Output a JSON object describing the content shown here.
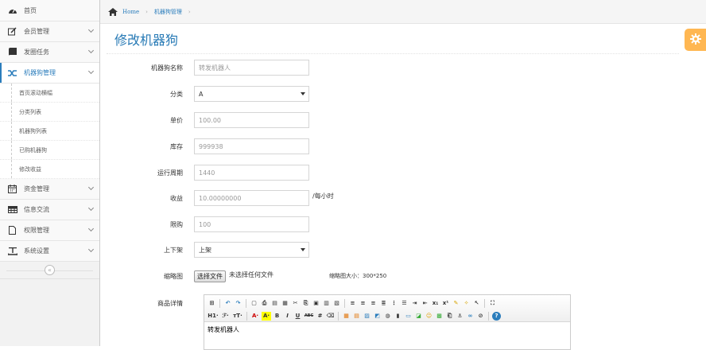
{
  "sidebar": {
    "items": [
      {
        "label": "首页",
        "icon": "dashboard-icon"
      },
      {
        "label": "会员管理",
        "icon": "pencil-square-icon"
      },
      {
        "label": "发圈任务",
        "icon": "book-icon"
      },
      {
        "label": "机器狗管理",
        "icon": "random-icon"
      },
      {
        "label": "资金管理",
        "icon": "calendar-icon"
      },
      {
        "label": "信息交流",
        "icon": "table-icon"
      },
      {
        "label": "权限管理",
        "icon": "file-icon"
      },
      {
        "label": "系统设置",
        "icon": "text-width-icon"
      }
    ],
    "subitems": [
      "首页滚动横幅",
      "分类列表",
      "机器狗列表",
      "已购机器狗",
      "修改收益"
    ],
    "collapse_label": "«"
  },
  "breadcrumb": {
    "home": "Home",
    "current": "机器狗管理"
  },
  "page": {
    "title": "修改机器狗"
  },
  "form": {
    "name": {
      "label": "机器狗名称",
      "placeholder": "转发机器人"
    },
    "category": {
      "label": "分类",
      "value": "A"
    },
    "price": {
      "label": "单价",
      "placeholder": "100.00"
    },
    "stock": {
      "label": "库存",
      "placeholder": "999938"
    },
    "period": {
      "label": "运行周期",
      "placeholder": "1440"
    },
    "income": {
      "label": "收益",
      "placeholder": "10.00000000",
      "suffix": "/每小时"
    },
    "limit": {
      "label": "限购",
      "placeholder": "100"
    },
    "status": {
      "label": "上下架",
      "value": "上架"
    },
    "thumb": {
      "label": "缩略图",
      "button": "选择文件",
      "file_text": "未选择任何文件",
      "note": "缩略图大小：300*250"
    },
    "detail": {
      "label": "商品详情",
      "content": "转发机器人"
    }
  },
  "editor_toolbar": {
    "row2_text": [
      "H1·",
      "ℱ·",
      "тT·",
      "A·",
      "A·",
      "B",
      "I",
      "U",
      "ABC"
    ]
  },
  "colors": {
    "accent": "#2b7dbc",
    "title": "#2679b5",
    "settings": "#ffb752"
  }
}
